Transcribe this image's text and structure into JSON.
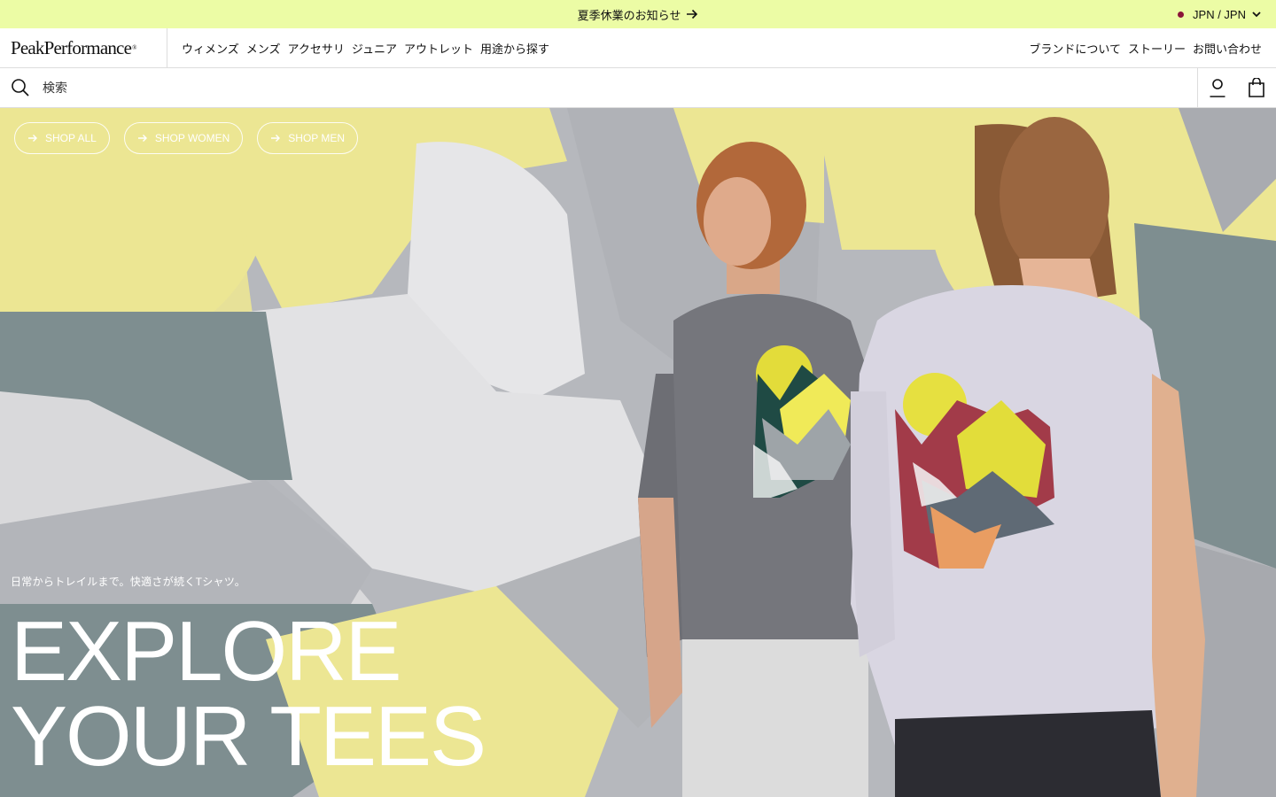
{
  "announcement": {
    "message": "夏季休業のお知らせ",
    "locale": "JPN / JPN"
  },
  "brand": {
    "logo_text": "PeakPerformance",
    "logo_mark": "®"
  },
  "nav": {
    "primary": [
      "ウィメンズ",
      "メンズ",
      "アクセサリ",
      "ジュニア",
      "アウトレット",
      "用途から探す"
    ],
    "secondary": [
      "ブランドについて",
      "ストーリー",
      "お問い合わせ"
    ]
  },
  "search": {
    "placeholder": "検索",
    "value": ""
  },
  "hero": {
    "buttons": [
      "SHOP ALL",
      "SHOP WOMEN",
      "SHOP MEN"
    ],
    "tagline": "日常からトレイルまで。快適さが続くTシャツ。",
    "headline_line1": "EXPLORE",
    "headline_line2": "YOUR TEES",
    "colors": {
      "yellow": "#ece693",
      "grey": "#b0b2b7",
      "dark_grey": "#7d8c8e",
      "light": "#e4e4e6"
    }
  },
  "icons": {
    "announcement_arrow": "arrow-right-icon",
    "locale_chevron": "chevron-down-icon",
    "search": "search-icon",
    "account": "account-icon",
    "bag": "shopping-bag-icon",
    "pill_arrow": "arrow-right-icon"
  },
  "colors": {
    "announcement_bg": "#ecfca5",
    "locale_dot": "#8a1538"
  }
}
